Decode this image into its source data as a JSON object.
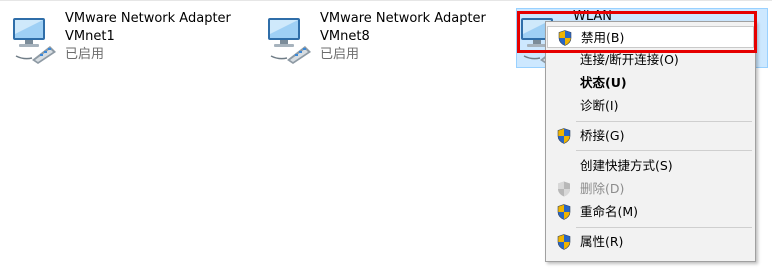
{
  "adapters": [
    {
      "name": "VMware Network Adapter",
      "device": "VMnet1",
      "status": "已启用"
    },
    {
      "name": "VMware Network Adapter",
      "device": "VMnet8",
      "status": "已启用"
    },
    {
      "name": "WLAN"
    }
  ],
  "context_menu": {
    "items": [
      {
        "label": "禁用(B)",
        "icon": "uac-shield-icon",
        "highlighted": true
      },
      {
        "label": "连接/断开连接(O)"
      },
      {
        "label": "状态(U)",
        "bold": true
      },
      {
        "label": "诊断(I)"
      },
      {
        "label": "桥接(G)",
        "icon": "uac-shield-icon"
      },
      {
        "label": "创建快捷方式(S)"
      },
      {
        "label": "删除(D)",
        "icon": "uac-shield-icon",
        "disabled": true
      },
      {
        "label": "重命名(M)",
        "icon": "uac-shield-icon"
      },
      {
        "label": "属性(R)",
        "icon": "uac-shield-icon"
      }
    ]
  },
  "colors": {
    "selection_bg": "#cde8ff",
    "menu_bg": "#f2f2f2",
    "annotation_red": "#e60000",
    "disabled_text": "#8c8c8c"
  }
}
